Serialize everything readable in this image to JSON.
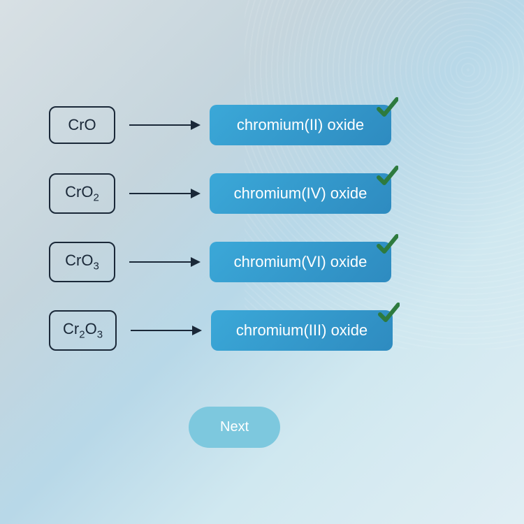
{
  "rows": [
    {
      "formula_parts": [
        "CrO"
      ],
      "answer": "chromium(II) oxide"
    },
    {
      "formula_parts": [
        "CrO",
        "2"
      ],
      "answer": "chromium(IV) oxide"
    },
    {
      "formula_parts": [
        "CrO",
        "3"
      ],
      "answer": "chromium(VI) oxide"
    },
    {
      "formula_parts": [
        "Cr",
        "2",
        "O",
        "3"
      ],
      "answer": "chromium(III) oxide"
    }
  ],
  "next_label": "Next",
  "colors": {
    "answer_bg": "#3ba8d8",
    "check": "#2d7a3e",
    "border": "#1a2838"
  }
}
